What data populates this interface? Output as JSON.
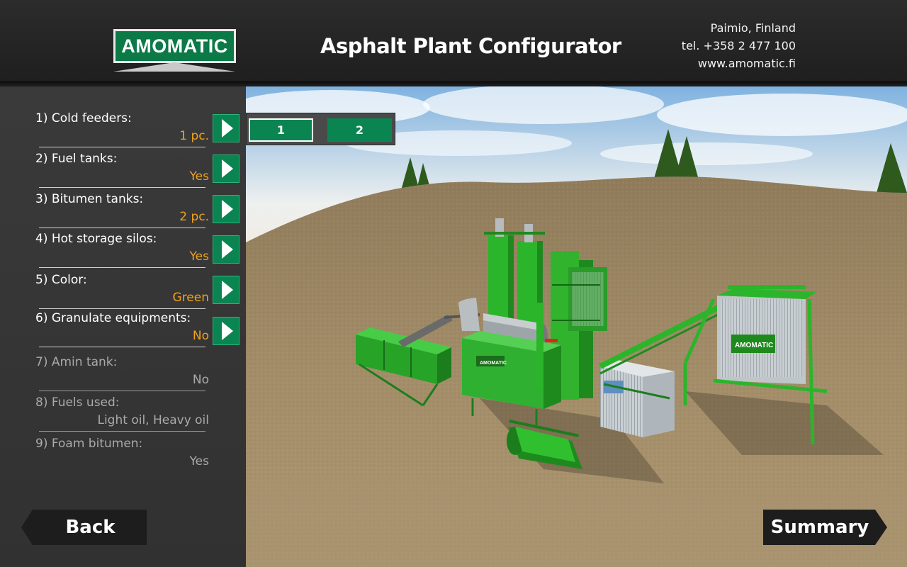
{
  "header": {
    "logo_text": "AMOMATIC",
    "title": "Asphalt Plant Configurator",
    "contact": [
      "Paimio, Finland",
      "tel. +358 2 477 100",
      "www.amomatic.fi"
    ]
  },
  "options": [
    {
      "label": "1) Cold feeders:",
      "value": "1 pc.",
      "enabled": true
    },
    {
      "label": "2) Fuel tanks:",
      "value": "Yes",
      "enabled": true
    },
    {
      "label": "3) Bitumen tanks:",
      "value": "2 pc.",
      "enabled": true
    },
    {
      "label": "4) Hot storage silos:",
      "value": "Yes",
      "enabled": true
    },
    {
      "label": "5) Color:",
      "value": "Green",
      "enabled": true
    },
    {
      "label": "6) Granulate equipments:",
      "value": "No",
      "enabled": true
    },
    {
      "label": "7) Amin tank:",
      "value": "No",
      "enabled": false
    },
    {
      "label": "8) Fuels used:",
      "value": "Light oil, Heavy oil",
      "enabled": false
    },
    {
      "label": "9) Foam bitumen:",
      "value": "Yes",
      "enabled": false
    }
  ],
  "selector": {
    "options": [
      "1",
      "2"
    ],
    "selected": "1"
  },
  "navigation": {
    "back_label": "Back",
    "summary_label": "Summary"
  },
  "scene": {
    "sign_text": "AMOMATIC"
  },
  "colors": {
    "accent_green": "#0a8552",
    "value_orange": "#f1a21c",
    "plant_green": "#2bb52b"
  }
}
